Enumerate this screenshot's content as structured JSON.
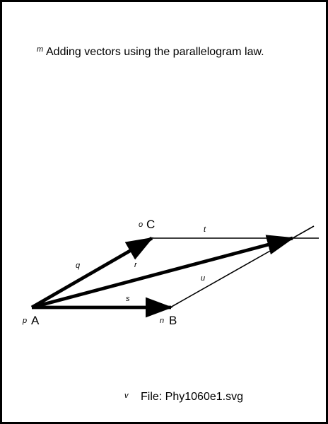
{
  "caption": {
    "tag": "m",
    "text": "Adding vectors using the parallelogram law."
  },
  "points": {
    "A": {
      "tag": "p",
      "label": "A"
    },
    "B": {
      "tag": "n",
      "label": "B"
    },
    "C": {
      "tag": "o",
      "label": "C"
    }
  },
  "vectors": {
    "AB": {
      "tag": "s"
    },
    "AC": {
      "tag": "q"
    },
    "AD": {
      "tag": "r"
    }
  },
  "construction_lines": {
    "CD": {
      "tag": "t"
    },
    "BD": {
      "tag": "u"
    }
  },
  "footer": {
    "tag": "v",
    "text": "File: Phy1060e1.svg"
  },
  "colors": {
    "background": "#ffffff",
    "frame": "#000000",
    "ink": "#000000"
  }
}
